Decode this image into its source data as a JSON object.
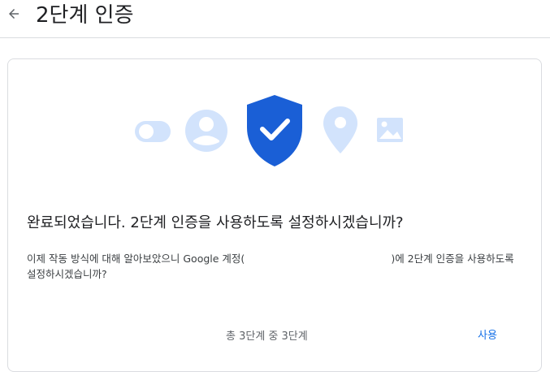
{
  "header": {
    "title": "2단계 인증",
    "back_icon": "arrow-left-icon"
  },
  "card": {
    "illustration_icons": [
      "toggle-icon",
      "person-icon",
      "shield-check-icon",
      "location-pin-icon",
      "photo-icon"
    ],
    "heading": "완료되었습니다. 2단계 인증을 사용하도록 설정하시겠습니까?",
    "description_part1": "이제 작동 방식에 대해 알아보았으니 Google 계정(",
    "description_part2": ")에 2단계 인증을 사용하도록 설정하시겠습니까?",
    "step_text": "총 3단계 중 3단계",
    "use_button": "사용"
  },
  "colors": {
    "accent": "#1a73e8",
    "shield": "#1a5fd6",
    "light_icon": "#d2e3fc"
  }
}
